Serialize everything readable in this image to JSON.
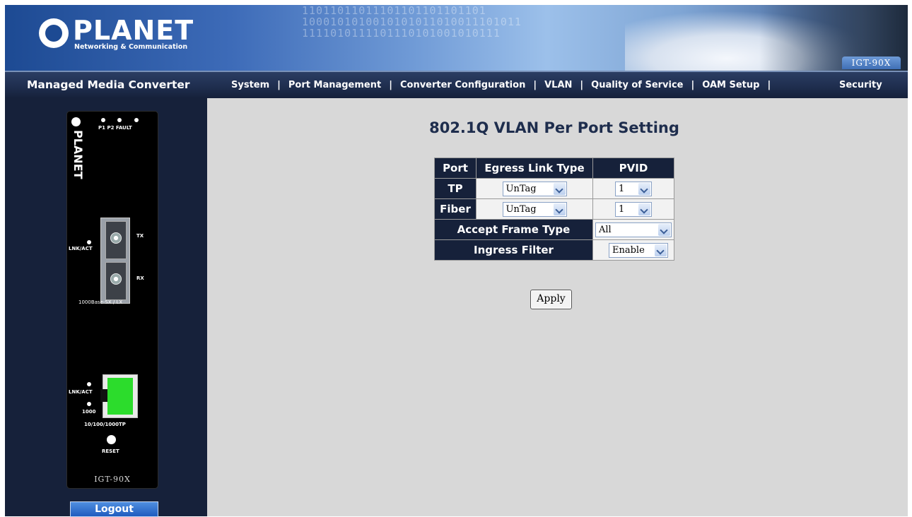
{
  "header": {
    "logo_text": "PLANET",
    "logo_subtitle": "Networking & Communication",
    "model_badge": "IGT-90X",
    "banner_bits": "11011011011101101101101101\n1000101010010101011010011101011\n1111010111101110101001010111"
  },
  "navbar": {
    "brand": "Managed Media Converter",
    "items": [
      "System",
      "Port Management",
      "Converter Configuration",
      "VLAN",
      "Quality of Service",
      "OAM Setup"
    ],
    "security": "Security",
    "separator": "|"
  },
  "device": {
    "led_labels": "P1  P2 FAULT",
    "brand_vertical": "PLANET",
    "tx": "TX",
    "rx": "RX",
    "lnk_act_fiber": "LNK/ACT",
    "fiber_label": "1000Base-SX / LX",
    "lnk_act_tp": "LNK/ACT",
    "speed_label": "1000",
    "tp_label": "10/100/1000TP",
    "reset": "RESET",
    "model": "IGT-90X"
  },
  "logout_label": "Logout",
  "main": {
    "title": "802.1Q VLAN Per Port Setting",
    "table": {
      "headers": [
        "Port",
        "Egress Link Type",
        "PVID"
      ],
      "rows": [
        {
          "port": "TP",
          "egress": "UnTag",
          "pvid": "1"
        },
        {
          "port": "Fiber",
          "egress": "UnTag",
          "pvid": "1"
        }
      ],
      "accept_frame_label": "Accept Frame Type",
      "accept_frame_value": "All",
      "ingress_label": "Ingress Filter",
      "ingress_value": "Enable"
    },
    "apply_label": "Apply"
  },
  "colors": {
    "navbar": "#1e2d4d",
    "table_header": "#16213a",
    "content_bg": "#d8d8d8",
    "rj45_port": "#2cdc2c"
  }
}
